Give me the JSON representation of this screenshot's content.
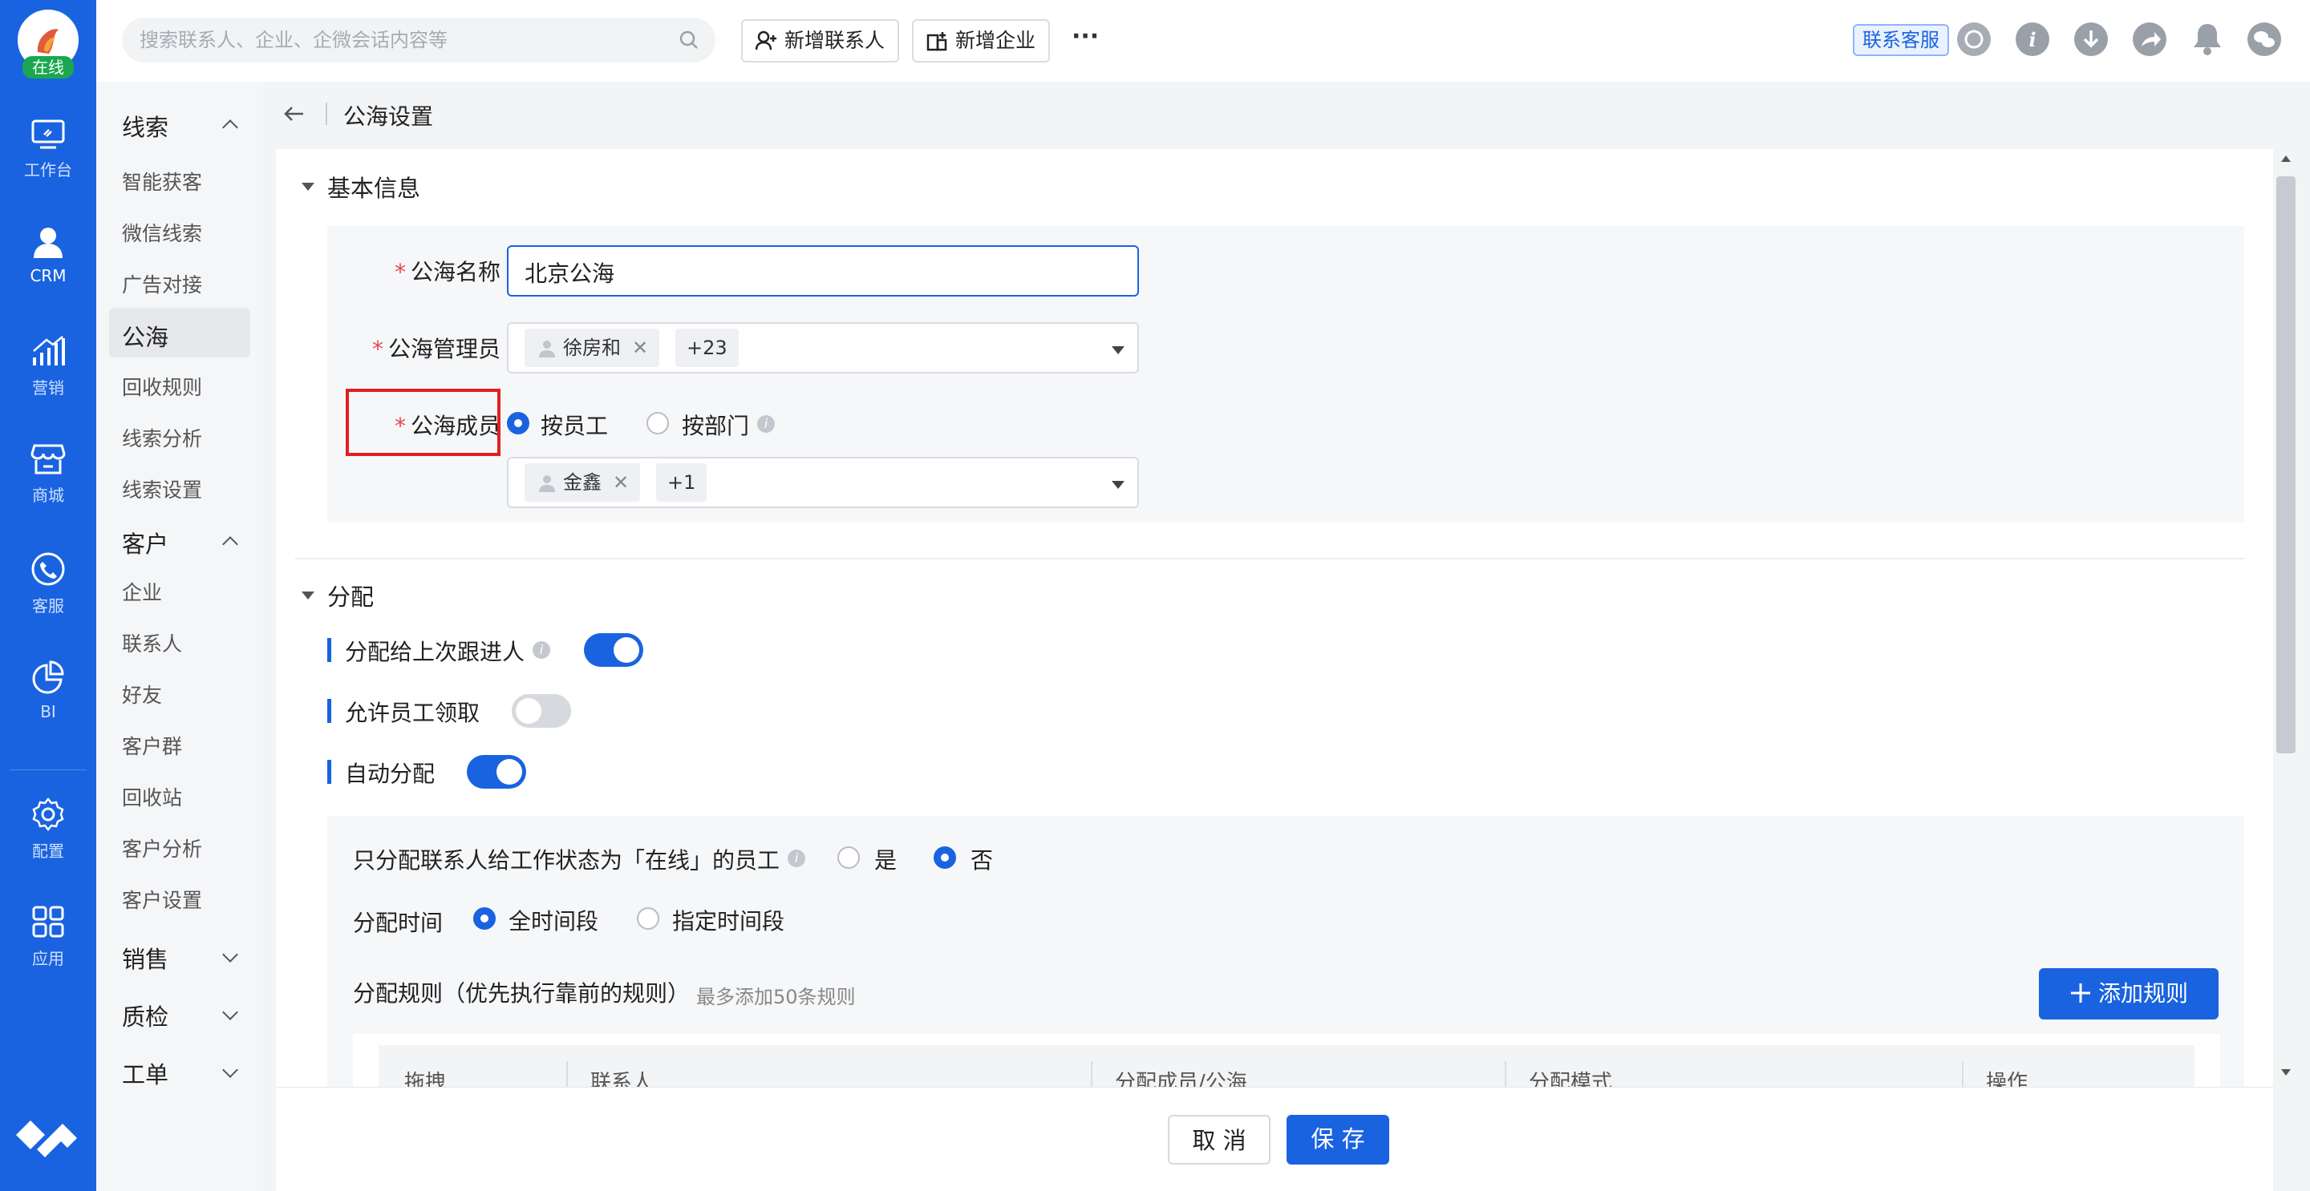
{
  "rail": {
    "status": "在线",
    "items": [
      "工作台",
      "CRM",
      "营销",
      "商城",
      "客服",
      "BI",
      "配置",
      "应用"
    ]
  },
  "topbar": {
    "search_placeholder": "搜索联系人、企业、企微会话内容等",
    "new_contact": "新增联系人",
    "new_company": "新增企业",
    "more": "···",
    "contact_service": "联系客服"
  },
  "sidenav": {
    "groups": [
      {
        "label": "线索",
        "items": [
          "智能获客",
          "微信线索",
          "广告对接",
          "公海",
          "回收规则",
          "线索分析",
          "线索设置"
        ]
      },
      {
        "label": "客户",
        "items": [
          "企业",
          "联系人",
          "好友",
          "客户群",
          "回收站",
          "客户分析",
          "客户设置"
        ]
      },
      {
        "label": "销售"
      },
      {
        "label": "质检"
      },
      {
        "label": "工单"
      }
    ]
  },
  "breadcrumb": {
    "title": "公海设置"
  },
  "basic": {
    "title": "基本信息",
    "name_label": "公海名称",
    "name_value": "北京公海",
    "admin_label": "公海管理员",
    "admin_tag": "徐房和",
    "admin_more": "+23",
    "member_label": "公海成员",
    "by_employee": "按员工",
    "by_dept": "按部门",
    "member_tag": "金鑫",
    "member_more": "+1"
  },
  "assign": {
    "title": "分配",
    "last_follower": "分配给上次跟进人",
    "allow_claim": "允许员工领取",
    "auto_assign": "自动分配",
    "online_only": "只分配联系人给工作状态为「在线」的员工",
    "yes": "是",
    "no": "否",
    "time_label": "分配时间",
    "all_time": "全时间段",
    "specified_time": "指定时间段",
    "rules_label": "分配规则（优先执行靠前的规则）",
    "rules_hint": "最多添加50条规则",
    "add_rule": "添加规则",
    "columns": [
      "拖拽",
      "联系人",
      "分配成员/公海",
      "分配模式",
      "操作"
    ]
  },
  "footer": {
    "cancel": "取 消",
    "save": "保 存"
  }
}
